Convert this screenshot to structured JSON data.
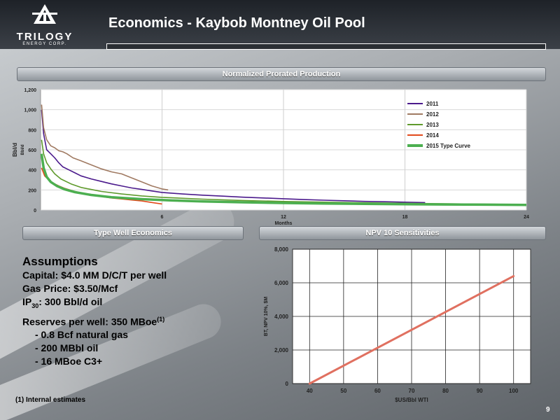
{
  "header": {
    "company": "TRILOGY",
    "company_sub": "ENERGY CORP.",
    "title": "Economics - Kaybob Montney Oil Pool"
  },
  "panels": {
    "production": "Normalized Prorated Production",
    "type_well": "Type Well Economics",
    "npv": "NPV 10 Sensitivities"
  },
  "assumptions": {
    "title": "Assumptions",
    "capital": "Capital: $4.0 MM D/C/T per well",
    "gas_price": "Gas Price: $3.50/Mcf",
    "ip_prefix": "IP",
    "ip_sub": "30",
    "ip_suffix": ": 300 Bbl/d oil",
    "reserves": "Reserves per well: 350 MBoe",
    "reserves_sup": "(1)",
    "items": [
      "- 0.8 Bcf natural gas",
      "- 200 MBbl oil",
      "- 16 MBoe C3+"
    ]
  },
  "footnote": "(1) Internal estimates",
  "page_number": "9",
  "colors": {
    "s2011": "#4b1a8c",
    "s2012": "#a07a62",
    "s2013": "#5f9a2c",
    "s2014": "#e24a1c",
    "type_curve": "#4caf50",
    "npv_line": "#e07060"
  },
  "chart_data": [
    {
      "type": "line",
      "title": "Normalized Prorated Production",
      "xlabel": "Months",
      "ylabel": "Bbl/d",
      "ylabel_secondary": "Bbl/d",
      "xlim": [
        0,
        24
      ],
      "ylim": [
        0,
        1200
      ],
      "x_ticks": [
        6,
        12,
        18,
        24
      ],
      "x_tick_labels": [
        "6",
        "12",
        "18",
        "24"
      ],
      "y_ticks": [
        0,
        200,
        400,
        600,
        800,
        1000,
        1200
      ],
      "y_tick_labels": [
        "0",
        "200",
        "400",
        "600",
        "800",
        "1,000",
        "1,200"
      ],
      "grid": true,
      "legend": "top-right",
      "series": [
        {
          "name": "2011",
          "color_key": "s2011",
          "points": [
            [
              0.05,
              1000
            ],
            [
              0.15,
              760
            ],
            [
              0.3,
              600
            ],
            [
              0.5,
              560
            ],
            [
              0.7,
              520
            ],
            [
              0.9,
              470
            ],
            [
              1.1,
              430
            ],
            [
              1.4,
              400
            ],
            [
              1.7,
              370
            ],
            [
              2.0,
              340
            ],
            [
              2.5,
              310
            ],
            [
              3,
              285
            ],
            [
              3.5,
              260
            ],
            [
              4,
              240
            ],
            [
              4.5,
              220
            ],
            [
              5,
              205
            ],
            [
              5.5,
              190
            ],
            [
              6,
              175
            ],
            [
              7,
              160
            ],
            [
              8,
              148
            ],
            [
              9,
              138
            ],
            [
              10,
              128
            ],
            [
              11,
              120
            ],
            [
              12,
              112
            ],
            [
              13,
              104
            ],
            [
              14,
              98
            ],
            [
              15,
              92
            ],
            [
              16,
              86
            ],
            [
              17,
              82
            ],
            [
              18,
              78
            ],
            [
              19,
              74
            ]
          ]
        },
        {
          "name": "2012",
          "color_key": "s2012",
          "points": [
            [
              0.05,
              1050
            ],
            [
              0.15,
              820
            ],
            [
              0.3,
              700
            ],
            [
              0.5,
              640
            ],
            [
              0.7,
              620
            ],
            [
              0.9,
              590
            ],
            [
              1.1,
              580
            ],
            [
              1.3,
              560
            ],
            [
              1.6,
              520
            ],
            [
              2,
              490
            ],
            [
              2.5,
              450
            ],
            [
              3,
              410
            ],
            [
              3.5,
              380
            ],
            [
              4,
              360
            ],
            [
              4.5,
              320
            ],
            [
              5,
              280
            ],
            [
              5.5,
              240
            ],
            [
              6,
              210
            ],
            [
              6.3,
              200
            ]
          ]
        },
        {
          "name": "2013",
          "color_key": "s2013",
          "points": [
            [
              0.05,
              700
            ],
            [
              0.15,
              560
            ],
            [
              0.3,
              470
            ],
            [
              0.5,
              410
            ],
            [
              0.7,
              360
            ],
            [
              1,
              310
            ],
            [
              1.5,
              260
            ],
            [
              2,
              225
            ],
            [
              3,
              185
            ],
            [
              4,
              160
            ],
            [
              5,
              140
            ],
            [
              6,
              126
            ],
            [
              8,
              108
            ],
            [
              10,
              95
            ],
            [
              12,
              85
            ],
            [
              14,
              78
            ],
            [
              16,
              72
            ],
            [
              18,
              67
            ],
            [
              20,
              62
            ],
            [
              22,
              58
            ],
            [
              24,
              55
            ]
          ]
        },
        {
          "name": "2014",
          "color_key": "s2014",
          "points": [
            [
              0.05,
              420
            ],
            [
              0.2,
              340
            ],
            [
              0.4,
              300
            ],
            [
              0.6,
              270
            ],
            [
              0.9,
              240
            ],
            [
              1.2,
              215
            ],
            [
              1.6,
              190
            ],
            [
              2,
              170
            ],
            [
              2.5,
              150
            ],
            [
              3,
              135
            ],
            [
              3.5,
              120
            ],
            [
              4,
              110
            ],
            [
              4.5,
              100
            ],
            [
              5,
              90
            ],
            [
              5.5,
              75
            ],
            [
              6,
              60
            ]
          ]
        },
        {
          "name": "2015 Type Curve",
          "color_key": "type_curve",
          "points": [
            [
              0.05,
              560
            ],
            [
              0.15,
              420
            ],
            [
              0.3,
              330
            ],
            [
              0.5,
              280
            ],
            [
              0.8,
              240
            ],
            [
              1.2,
              205
            ],
            [
              1.7,
              178
            ],
            [
              2.5,
              150
            ],
            [
              3.5,
              128
            ],
            [
              5,
              108
            ],
            [
              6.5,
              95
            ],
            [
              8,
              86
            ],
            [
              10,
              77
            ],
            [
              12,
              70
            ],
            [
              14,
              65
            ],
            [
              16,
              61
            ],
            [
              18,
              58
            ],
            [
              20,
              55
            ],
            [
              22,
              53
            ],
            [
              24,
              51
            ]
          ]
        }
      ]
    },
    {
      "type": "line",
      "title": "NPV 10 Sensitivities",
      "xlabel": "$US/Bbl WTI",
      "ylabel": "BT, NPV 10%, $M",
      "xlim": [
        35,
        105
      ],
      "ylim": [
        0,
        8000
      ],
      "x_ticks": [
        40,
        50,
        60,
        70,
        80,
        90,
        100
      ],
      "x_tick_labels": [
        "40",
        "50",
        "60",
        "70",
        "80",
        "90",
        "100"
      ],
      "y_ticks": [
        0,
        2000,
        4000,
        6000,
        8000
      ],
      "y_tick_labels": [
        "0",
        "2,000",
        "4,000",
        "6,000",
        "8,000"
      ],
      "grid": true,
      "series": [
        {
          "color_key": "npv_line",
          "x": [
            40,
            100
          ],
          "y": [
            0,
            6400
          ]
        }
      ]
    }
  ]
}
